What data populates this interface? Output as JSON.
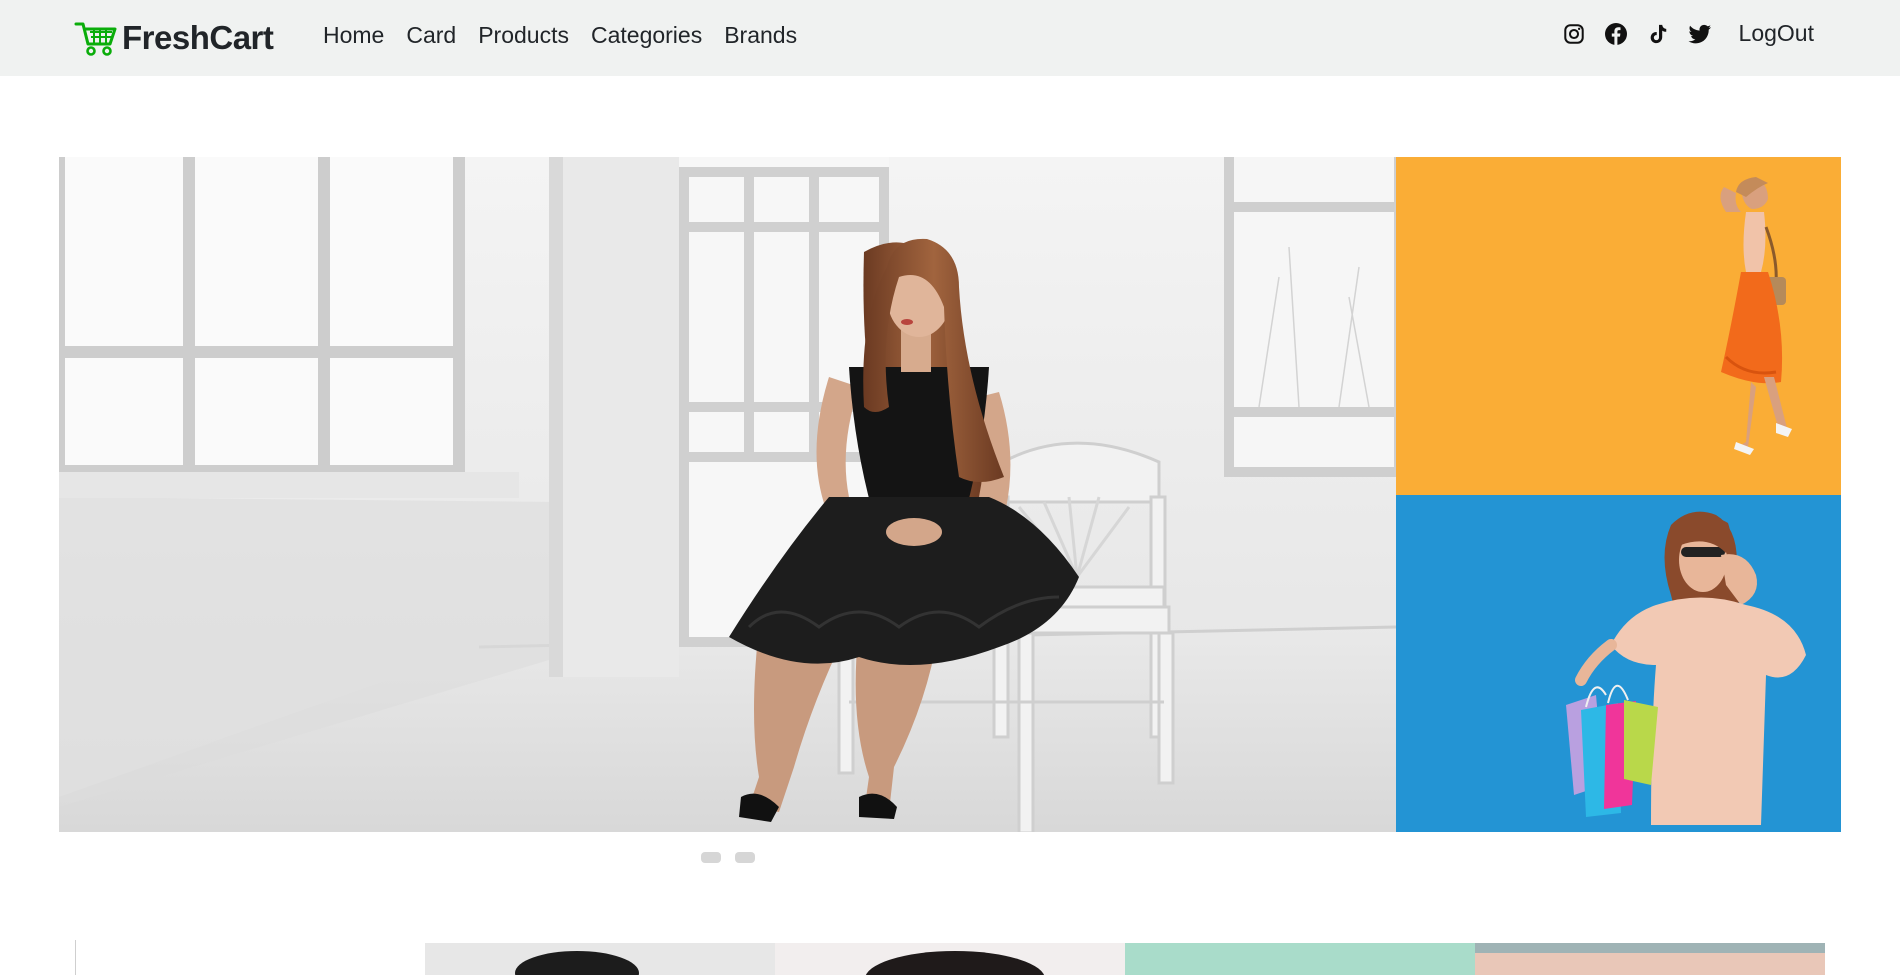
{
  "brand": {
    "name": "FreshCart",
    "icon": "shopping-cart-icon",
    "icon_color": "#0aad0a"
  },
  "nav": {
    "links": [
      "Home",
      "Card",
      "Products",
      "Categories",
      "Brands"
    ]
  },
  "social": {
    "icons": [
      "instagram-icon",
      "facebook-icon",
      "tiktok-icon",
      "twitter-icon"
    ],
    "logout_label": "LogOut"
  },
  "hero": {
    "main_slide": "woman-black-dress-white-room",
    "side_top": "woman-orange-background",
    "side_bottom": "woman-blue-background-shopping-bags",
    "slide_count": 2,
    "active_slide": 1
  },
  "category_strip": {
    "items": [
      "category-slide-1",
      "category-slide-2",
      "category-slide-3",
      "category-slide-4"
    ]
  },
  "colors": {
    "navbar_bg": "#f0f2f1",
    "accent": "#0aad0a",
    "orange_panel": "#fbb03b",
    "blue_panel": "#1f8fcf"
  }
}
